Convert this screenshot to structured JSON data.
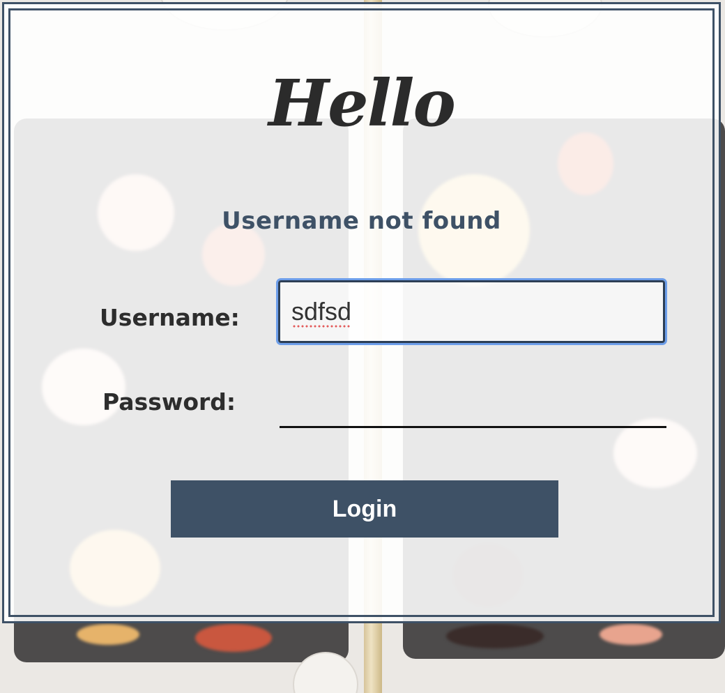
{
  "card": {
    "title": "Hello",
    "error_message": "Username not found"
  },
  "form": {
    "username_label": "Username:",
    "username_value": "sdfsd",
    "password_label": "Password:",
    "password_value": "",
    "login_label": "Login"
  },
  "colors": {
    "accent": "#3e5166",
    "focus_ring": "#6d9eea",
    "spellcheck": "#e25a5a"
  }
}
